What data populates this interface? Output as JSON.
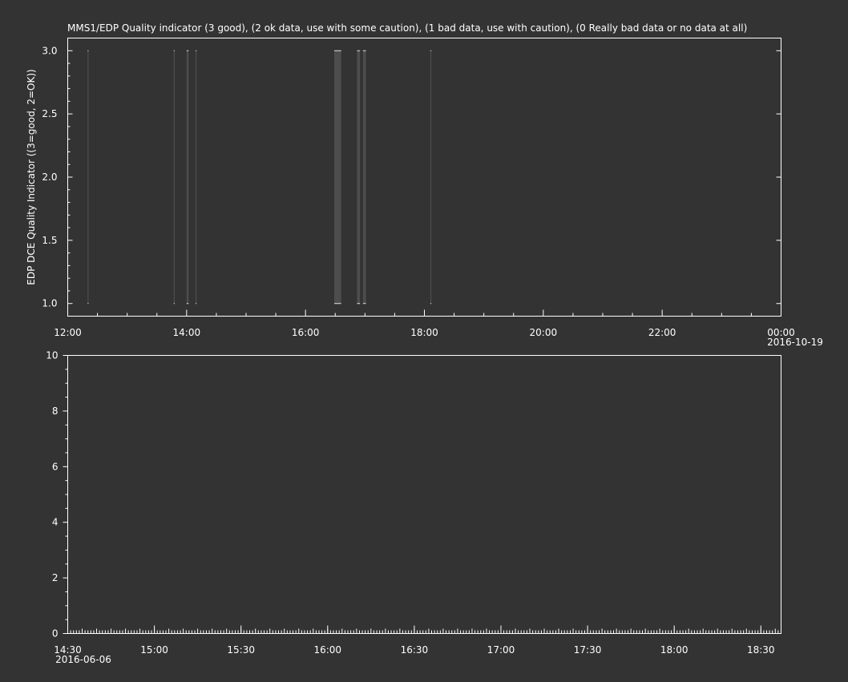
{
  "colors": {
    "background": "#333333",
    "foreground": "#ffffff",
    "data_fill": "#4d4d4d",
    "data_edge": "#e0e0e0"
  },
  "chart_data": [
    {
      "type": "bar",
      "title": "MMS1/EDP  Quality indicator (3 good), (2 ok data, use with some caution), (1 bad data, use with caution), (0 Really bad data or no data at all)",
      "ylabel": "EDP DCE Quality Indicator ((3=good, 2=OK))",
      "xlabel": "",
      "x_axis": "time",
      "xlim": [
        "12:00",
        "00:00"
      ],
      "ylim": [
        0.9,
        3.1
      ],
      "x_ticks": [
        "12:00",
        "14:00",
        "16:00",
        "18:00",
        "20:00",
        "22:00",
        "00:00"
      ],
      "x_date_label": "2016-10-19",
      "y_ticks": [
        "1.0",
        "1.5",
        "2.0",
        "2.5",
        "3.0"
      ],
      "baseline": 1.0,
      "series": [
        {
          "segments": [
            {
              "start": "12:20",
              "end": "12:21",
              "value": 3.0
            },
            {
              "start": "13:47",
              "end": "13:48",
              "value": 3.0
            },
            {
              "start": "14:00",
              "end": "14:02",
              "value": 3.0
            },
            {
              "start": "14:09",
              "end": "14:10",
              "value": 3.0
            },
            {
              "start": "16:29",
              "end": "16:36",
              "value": 3.0
            },
            {
              "start": "16:52",
              "end": "16:55",
              "value": 3.0
            },
            {
              "start": "16:58",
              "end": "17:01",
              "value": 3.0
            },
            {
              "start": "18:06",
              "end": "18:07",
              "value": 3.0
            }
          ]
        }
      ],
      "grid": false
    },
    {
      "type": "line",
      "title": "",
      "xlabel": "",
      "ylabel": "",
      "x_axis": "time",
      "xlim": [
        "14:30",
        "18:37"
      ],
      "ylim": [
        0,
        10
      ],
      "x_ticks": [
        "14:30",
        "15:00",
        "15:30",
        "16:00",
        "16:30",
        "17:00",
        "17:30",
        "18:00",
        "18:30"
      ],
      "x_date_label": "2016-06-06",
      "y_ticks": [
        "0",
        "2",
        "4",
        "6",
        "8",
        "10"
      ],
      "series": [],
      "grid": false
    }
  ]
}
